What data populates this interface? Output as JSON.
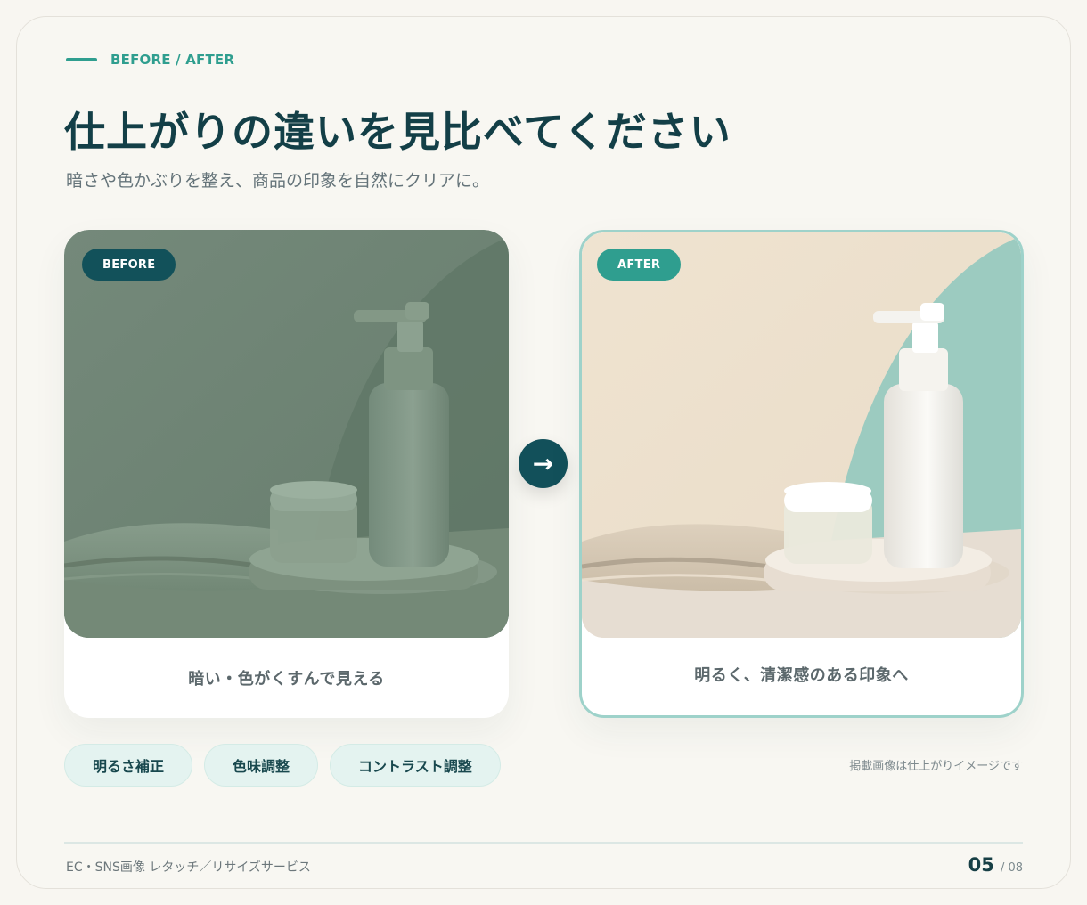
{
  "eyebrow": "BEFORE / AFTER",
  "title": "仕上がりの違いを見比べてください",
  "subtitle": "暗さや色かぶりを整え、商品の印象を自然にクリアに。",
  "before": {
    "badge": "BEFORE",
    "caption": "暗い・色がくすんで見える"
  },
  "after": {
    "badge": "AFTER",
    "caption": "明るく、清潔感のある印象へ"
  },
  "arrow_icon": "→",
  "chips": [
    "明るさ補正",
    "色味調整",
    "コントラスト調整"
  ],
  "note": "掲載画像は仕上がりイメージです",
  "footer": {
    "service": "EC・SNS画像 レタッチ／リサイズサービス",
    "page_current": "05",
    "page_total": "/ 08"
  },
  "colors": {
    "accent": "#2f9e8f",
    "dark": "#12515a",
    "background": "#f8f6f1"
  }
}
